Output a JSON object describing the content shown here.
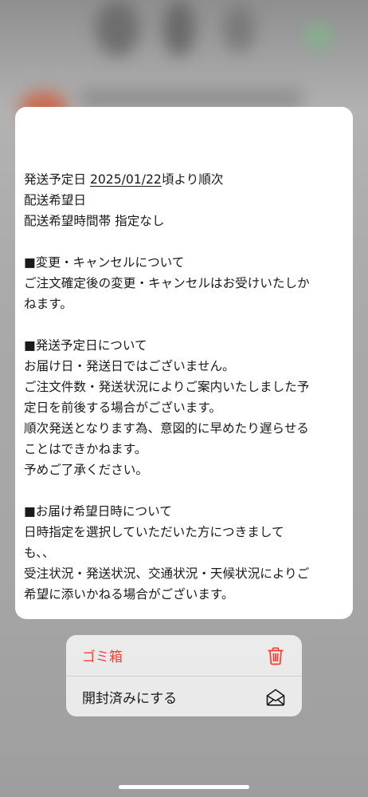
{
  "preview": {
    "line1_prefix": "発送予定日 ",
    "line1_date": "2025/01/22",
    "line1_suffix": "頃より順次",
    "lines": [
      "配送希望日",
      "配送希望時間帯 指定なし",
      "",
      "■変更・キャンセルについて",
      "ご注文確定後の変更・キャンセルはお受けいたしか",
      "ねます。",
      "",
      "■発送予定日について",
      "お届け日・発送日ではございません。",
      "ご注文件数・発送状況によりご案内いたしました予",
      "定日を前後する場合がございます。",
      "順次発送となります為、意図的に早めたり遅らせる",
      "ことはできかねます。",
      "予めご了承ください。",
      "",
      "■お届け希望日時について",
      "日時指定を選択していただいた方につきまして",
      "も、、",
      "受注状況・発送状況、交通状況・天候状況によりご",
      "希望に添いかねる場合がございます。"
    ]
  },
  "menu": {
    "trash_label": "ゴミ箱",
    "trash_icon": "trash-icon",
    "mark_opened_label": "開封済みにする",
    "mark_opened_icon": "open-envelope-icon"
  },
  "colors": {
    "destructive": "#ff3b30",
    "text": "#1a1a1a"
  }
}
